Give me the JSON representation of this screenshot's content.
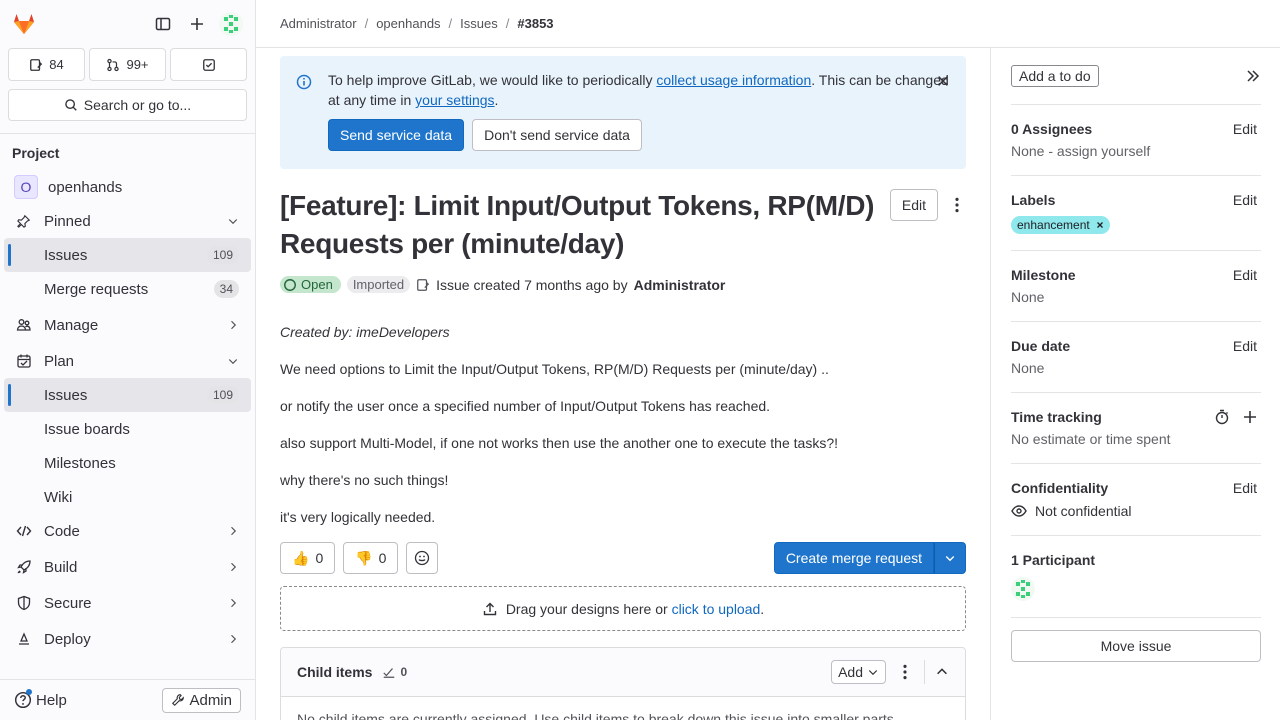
{
  "sidebar": {
    "issues_count": "84",
    "mr_count": "99+",
    "search_label": "Search or go to...",
    "section_title": "Project",
    "project_initial": "O",
    "project_name": "openhands",
    "pinned_label": "Pinned",
    "pinned_items": [
      {
        "label": "Issues",
        "count": "109"
      },
      {
        "label": "Merge requests",
        "count": "34"
      }
    ],
    "manage_label": "Manage",
    "plan_label": "Plan",
    "plan_items": [
      {
        "label": "Issues",
        "count": "109"
      },
      {
        "label": "Issue boards"
      },
      {
        "label": "Milestones"
      },
      {
        "label": "Wiki"
      }
    ],
    "code_label": "Code",
    "build_label": "Build",
    "secure_label": "Secure",
    "deploy_label": "Deploy",
    "help_label": "Help",
    "admin_label": "Admin"
  },
  "breadcrumb": [
    "Administrator",
    "openhands",
    "Issues",
    "#3853"
  ],
  "alert": {
    "text_before": "To help improve GitLab, we would like to periodically ",
    "link1": "collect usage information",
    "text_mid": ". This can be changed at any time in ",
    "link2": "your settings",
    "text_after": ".",
    "send_label": "Send service data",
    "dont_send_label": "Don't send service data"
  },
  "issue": {
    "title": "[Feature]: Limit Input/Output Tokens, RP(M/D) Requests per (minute/day)",
    "edit_label": "Edit",
    "status": "Open",
    "imported": "Imported",
    "created_text": "Issue created 7 months ago by",
    "author": "Administrator",
    "description": [
      "Created by: imeDevelopers",
      "We need options to Limit the Input/Output Tokens, RP(M/D) Requests per (minute/day) ..",
      "or notify the user once a specified number of Input/Output Tokens has reached.",
      "also support Multi-Model, if one not works then use the another one to execute the tasks?!",
      "why there's no such things!",
      "it's very logically needed."
    ],
    "thumbs_up": "0",
    "thumbs_down": "0",
    "create_mr_label": "Create merge request",
    "drop_text": "Drag your designs here or ",
    "drop_link": "click to upload",
    "drop_after": ".",
    "child_title": "Child items",
    "child_count": "0",
    "child_add": "Add",
    "child_empty": "No child items are currently assigned. Use child items to break down this issue into smaller parts."
  },
  "right": {
    "todo_label": "Add a to do",
    "assignees_title": "0 Assignees",
    "assignees_value": "None - assign yourself",
    "labels_title": "Labels",
    "label_name": "enhancement",
    "label_color": "#8fe8ec",
    "milestone_title": "Milestone",
    "milestone_value": "None",
    "due_title": "Due date",
    "due_value": "None",
    "time_title": "Time tracking",
    "time_value": "No estimate or time spent",
    "conf_title": "Confidentiality",
    "conf_value": "Not confidential",
    "participants_title": "1 Participant",
    "move_label": "Move issue",
    "edit_label": "Edit"
  }
}
